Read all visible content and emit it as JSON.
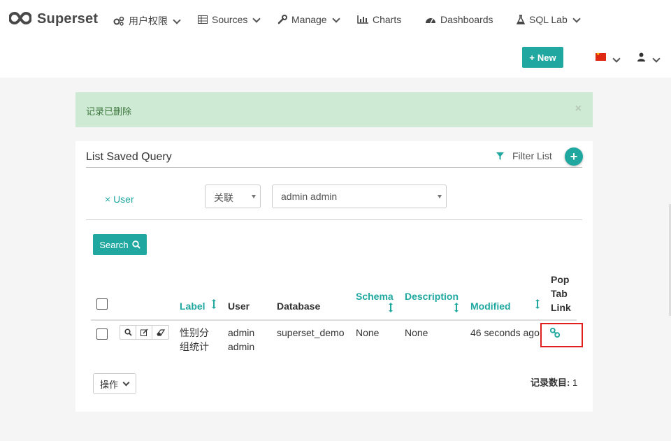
{
  "navbar": {
    "brand": "Superset",
    "items": [
      {
        "label": "用户权限",
        "icon": "gears-icon",
        "has_dropdown": true
      },
      {
        "label": "Sources",
        "icon": "table-icon",
        "has_dropdown": true
      },
      {
        "label": "Manage",
        "icon": "wrench-icon",
        "has_dropdown": true
      },
      {
        "label": "Charts",
        "icon": "bar-chart-icon",
        "has_dropdown": false
      },
      {
        "label": "Dashboards",
        "icon": "dashboard-icon",
        "has_dropdown": false
      },
      {
        "label": "SQL Lab",
        "icon": "flask-icon",
        "has_dropdown": true
      }
    ],
    "new_button": "New",
    "language_flag": "cn-flag-icon",
    "user_menu_icon": "user-icon"
  },
  "alert": {
    "message": "记录已删除",
    "close": "×"
  },
  "panel": {
    "title": "List Saved Query",
    "filter_list_label": "Filter List",
    "add_filter": "+",
    "filter": {
      "remove_label": "× User",
      "operator": "关联",
      "value": "admin admin"
    },
    "search_button": "Search",
    "table": {
      "headers": {
        "label": "Label",
        "user": "User",
        "database": "Database",
        "schema": "Schema",
        "description": "Description",
        "modified": "Modified",
        "pop_tab_link": [
          "Pop",
          "Tab",
          "Link"
        ]
      },
      "rows": [
        {
          "label": [
            "性别分",
            "组统计"
          ],
          "user": [
            "admin",
            "admin"
          ],
          "database": "superset_demo",
          "schema": "None",
          "description": "None",
          "modified": "46 seconds ago",
          "link_icon": "link-icon"
        }
      ]
    },
    "actions_button": "操作",
    "record_count_label": "记录数目:",
    "record_count": "1"
  },
  "colors": {
    "accent": "#20a7a0",
    "alert_bg": "#cfead4",
    "alert_text": "#3c763d",
    "highlight_border": "#e02020"
  }
}
